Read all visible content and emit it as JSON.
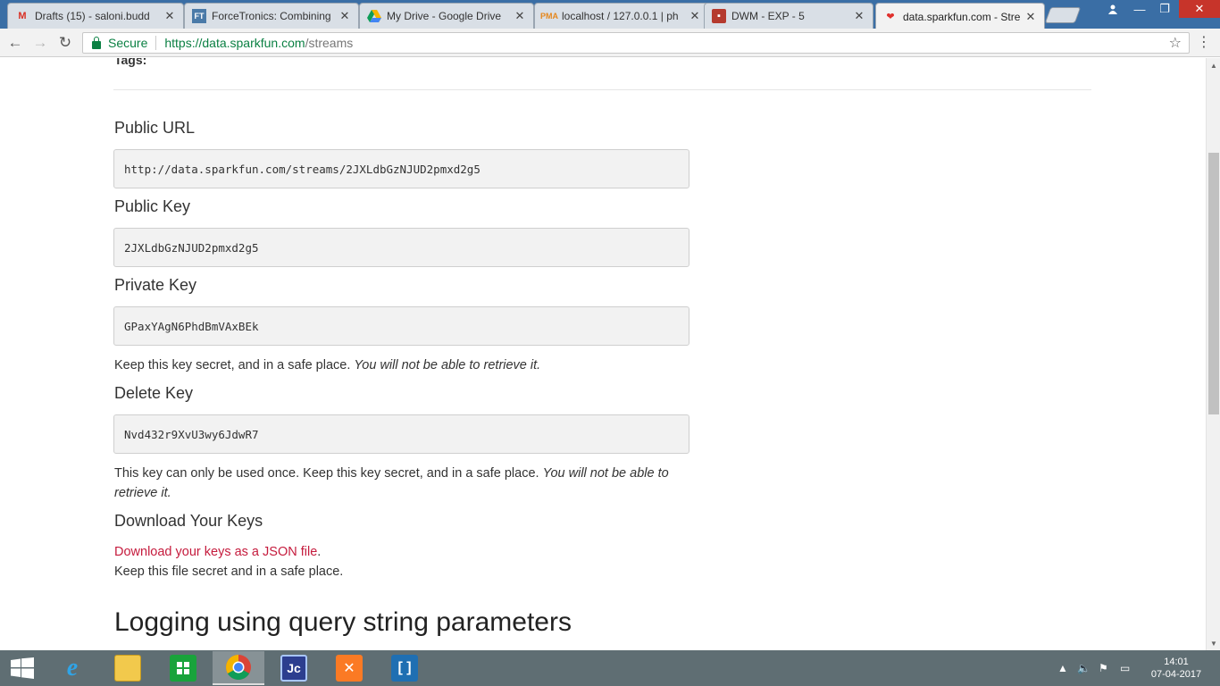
{
  "browser": {
    "tabs": [
      {
        "title": "Drafts (15) - saloni.budd",
        "icon": "gmail-icon"
      },
      {
        "title": "ForceTronics: Combining",
        "icon": "forcetronics-icon"
      },
      {
        "title": "My Drive - Google Drive",
        "icon": "google-drive-icon"
      },
      {
        "title": "localhost / 127.0.0.1 | ph",
        "icon": "phpmyadmin-icon"
      },
      {
        "title": "DWM - EXP - 5",
        "icon": "classroom-icon"
      },
      {
        "title": "data.sparkfun.com - Stre",
        "icon": "sparkfun-icon"
      }
    ],
    "active_tab": 5,
    "secure_label": "Secure",
    "url_host": "https://data.sparkfun.com",
    "url_path": "/streams"
  },
  "page": {
    "tags_label": "Tags:",
    "public_url": {
      "heading": "Public URL",
      "value": "http://data.sparkfun.com/streams/2JXLdbGzNJUD2pmxd2g5"
    },
    "public_key": {
      "heading": "Public Key",
      "value": "2JXLdbGzNJUD2pmxd2g5"
    },
    "private_key": {
      "heading": "Private Key",
      "value": "GPaxYAgN6PhdBmVAxBEk",
      "note": "Keep this key secret, and in a safe place.",
      "note_em": "You will not be able to retrieve it."
    },
    "delete_key": {
      "heading": "Delete Key",
      "value": "Nvd432r9XvU3wy6JdwR7",
      "note": "This key can only be used once.  Keep this key secret, and in a safe place.",
      "note_em": "You will not be able to retrieve it."
    },
    "download": {
      "heading": "Download Your Keys",
      "link": "Download your keys as a JSON file",
      "link_suffix": ".",
      "note": "Keep this file secret and in a safe place."
    },
    "logging_heading": "Logging using query string parameters"
  },
  "taskbar": {
    "time": "14:01",
    "date": "07-04-2017",
    "apps": [
      "internet-explorer-icon",
      "file-explorer-icon",
      "store-icon",
      "chrome-icon",
      "jcreator-icon",
      "xampp-icon",
      "brackets-icon"
    ],
    "active_app": "chrome-icon"
  },
  "colors": {
    "accent_link": "#c51b3d",
    "secure_green": "#0b8043",
    "taskbar": "#5f6e73",
    "tabstrip": "#3a6ea5"
  }
}
